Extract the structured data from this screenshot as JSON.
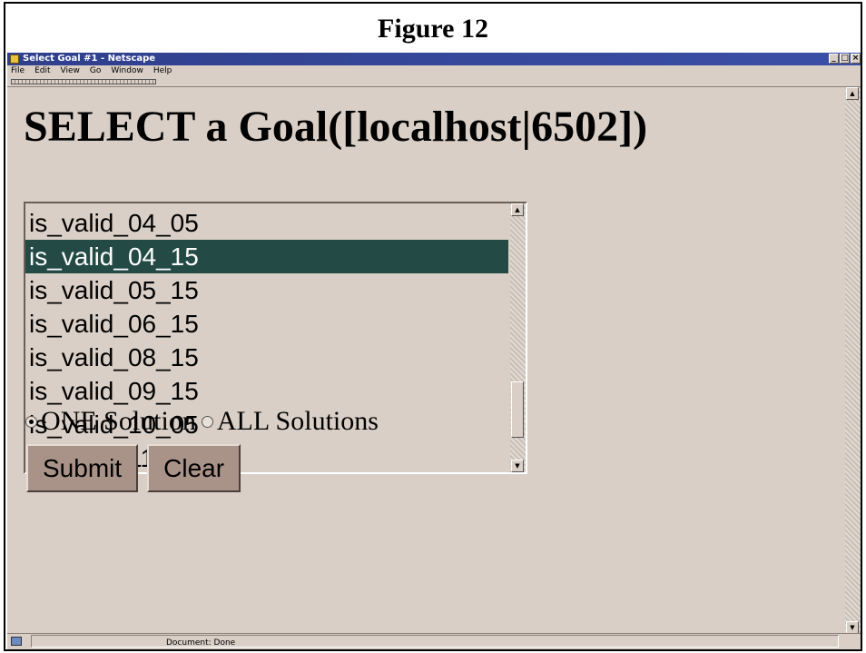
{
  "figure": {
    "title": "Figure 12"
  },
  "window": {
    "title": "Select Goal #1 - Netscape",
    "controls": {
      "minimize": "_",
      "maximize": "□",
      "close": "×"
    }
  },
  "menu": [
    "File",
    "Edit",
    "View",
    "Go",
    "Window",
    "Help"
  ],
  "page": {
    "heading": "SELECT a Goal([localhost|6502])",
    "goal_list": {
      "items": [
        "is_valid_04_05",
        "is_valid_04_15",
        "is_valid_05_15",
        "is_valid_06_15",
        "is_valid_08_15",
        "is_valid_09_15",
        "is_valid_10_05",
        "is_valid_11_15"
      ],
      "selected_index": 1
    },
    "solution_options": [
      {
        "label": "ONE Solution",
        "checked": true
      },
      {
        "label": "ALL Solutions",
        "checked": false
      }
    ],
    "buttons": {
      "submit": "Submit",
      "clear": "Clear"
    }
  },
  "status": {
    "text": "Document: Done"
  },
  "colors": {
    "window_bg": "#d9cfc6",
    "titlebar": "#2f3f8c",
    "selection": "#244a46",
    "button_face": "#a99389"
  }
}
